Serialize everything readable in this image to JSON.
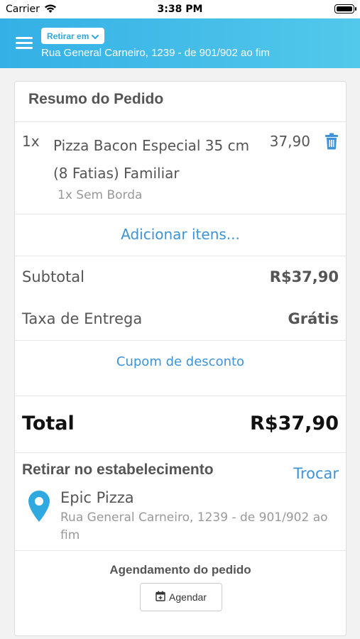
{
  "status_bar": {
    "carrier": "Carrier",
    "time": "3:38 PM",
    "icons": [
      "wifi-icon",
      "battery-icon"
    ]
  },
  "header": {
    "mode_label": "Retirar em",
    "address": "Rua General Carneiro, 1239 - de 901/902 ao fim",
    "background_colors": [
      "#34b0e6",
      "#52c8ea"
    ],
    "icons": [
      "menu-icon",
      "chevron-down-icon"
    ]
  },
  "order": {
    "title": "Resumo do Pedido",
    "items": [
      {
        "qty": "1x",
        "name": "Pizza Bacon Especial 35 cm (8 Fatias) Familiar",
        "price": "37,90",
        "option": "1x Sem Borda",
        "icon": "trash-icon"
      }
    ],
    "add_items_label": "Adicionar itens...",
    "subtotal_label": "Subtotal",
    "subtotal_value": "R$37,90",
    "delivery_fee_label": "Taxa de Entrega",
    "delivery_fee_value": "Grátis",
    "coupon_label": "Cupom de desconto",
    "total_label": "Total",
    "total_value": "R$37,90"
  },
  "pickup": {
    "title": "Retirar no estabelecimento",
    "change_label": "Trocar",
    "store_name": "Epic Pizza",
    "store_address": "Rua General Carneiro, 1239 - de 901/902 ao fim",
    "icon": "map-pin-icon"
  },
  "schedule": {
    "title": "Agendamento do pedido",
    "button_label": "Agendar",
    "icon": "calendar-plus-icon"
  },
  "colors": {
    "accent_link": "#3d93d9",
    "pin": "#2fa9e0"
  }
}
